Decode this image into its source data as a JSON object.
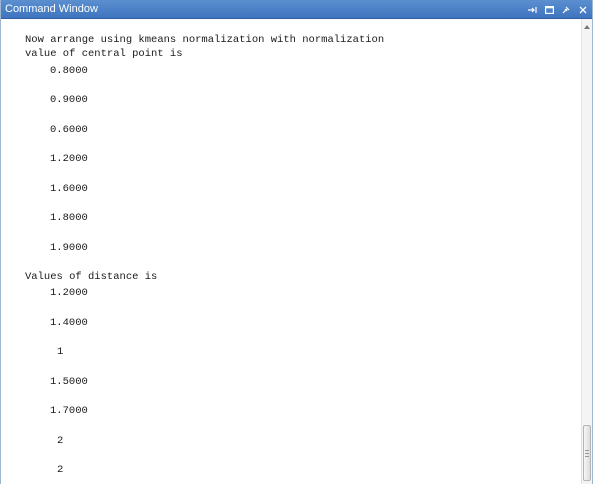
{
  "window": {
    "title": "Command Window",
    "controls": [
      "undock-icon",
      "maximize-icon",
      "pin-icon",
      "close-icon"
    ]
  },
  "output": {
    "header_1": "Now arrange using kmeans normalization with normalization",
    "header_2": "value of central point is",
    "central_points": [
      "0.8000",
      "0.9000",
      "0.6000",
      "1.2000",
      "1.6000",
      "1.8000",
      "1.9000"
    ],
    "distance_label": "Values of distance is",
    "distances": [
      "1.2000",
      "1.4000",
      "1",
      "1.5000",
      "1.7000",
      "2",
      "2"
    ]
  },
  "colors": {
    "titlebar": "#4a80c8",
    "title_text": "#ffffff",
    "content_bg": "#ffffff",
    "text": "#1a1a1a"
  }
}
